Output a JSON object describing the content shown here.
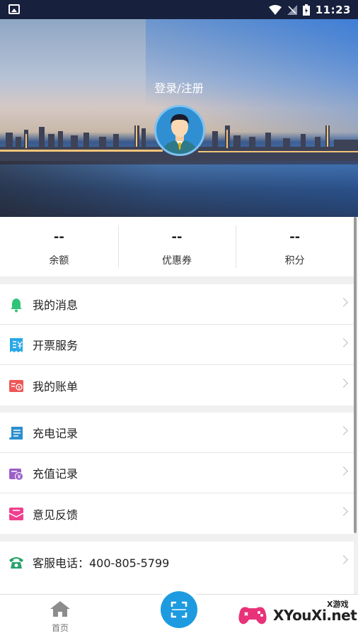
{
  "status_bar": {
    "time": "11:23"
  },
  "hero": {
    "login_label": "登录/注册"
  },
  "stats": [
    {
      "value": "--",
      "label": "余额"
    },
    {
      "value": "--",
      "label": "优惠券"
    },
    {
      "value": "--",
      "label": "积分"
    }
  ],
  "menu": {
    "group1": [
      {
        "label": "我的消息",
        "icon": "bell-icon",
        "color": "#2fc477"
      },
      {
        "label": "开票服务",
        "icon": "invoice-icon",
        "color": "#29a7e8"
      },
      {
        "label": "我的账单",
        "icon": "bill-icon",
        "color": "#ef5656"
      }
    ],
    "group2": [
      {
        "label": "充电记录",
        "icon": "charge-record-icon",
        "color": "#2a8fd0"
      },
      {
        "label": "充值记录",
        "icon": "recharge-record-icon",
        "color": "#9b5fc7"
      },
      {
        "label": "意见反馈",
        "icon": "feedback-icon",
        "color": "#ef3f8f"
      }
    ],
    "group3": [
      {
        "label": "客服电话：400-805-5799",
        "icon": "phone-icon",
        "color": "#27a36a"
      }
    ]
  },
  "bottom_nav": {
    "home_label": "首页"
  },
  "watermark": {
    "main": "XYouXi.net",
    "small": "X游戏"
  }
}
